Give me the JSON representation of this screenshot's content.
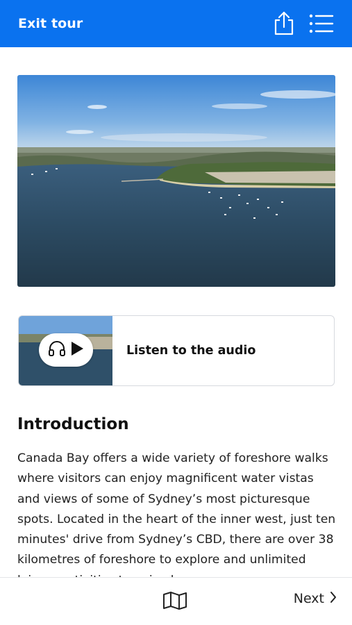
{
  "header": {
    "exit_label": "Exit tour",
    "background_color": "#0a72ef",
    "share_icon": "share-icon",
    "menu_icon": "list-menu-icon"
  },
  "hero_image": {
    "description_icon": "harbour-aerial-photo"
  },
  "audio": {
    "label": "Listen to the audio",
    "icons": [
      "headphones-icon",
      "play-icon"
    ]
  },
  "intro": {
    "title": "Introduction",
    "body": "Canada Bay offers a wide variety of foreshore walks where visitors can enjoy magnificent water vistas and views of some of Sydney’s most picturesque spots. Located in the heart of the inner west, just ten minutes' drive from Sydney’s CBD, there are over 38 kilometres of foreshore to explore and unlimited leisure activities to enjoy here."
  },
  "footer": {
    "map_icon": "map-icon",
    "next_label": "Next"
  }
}
